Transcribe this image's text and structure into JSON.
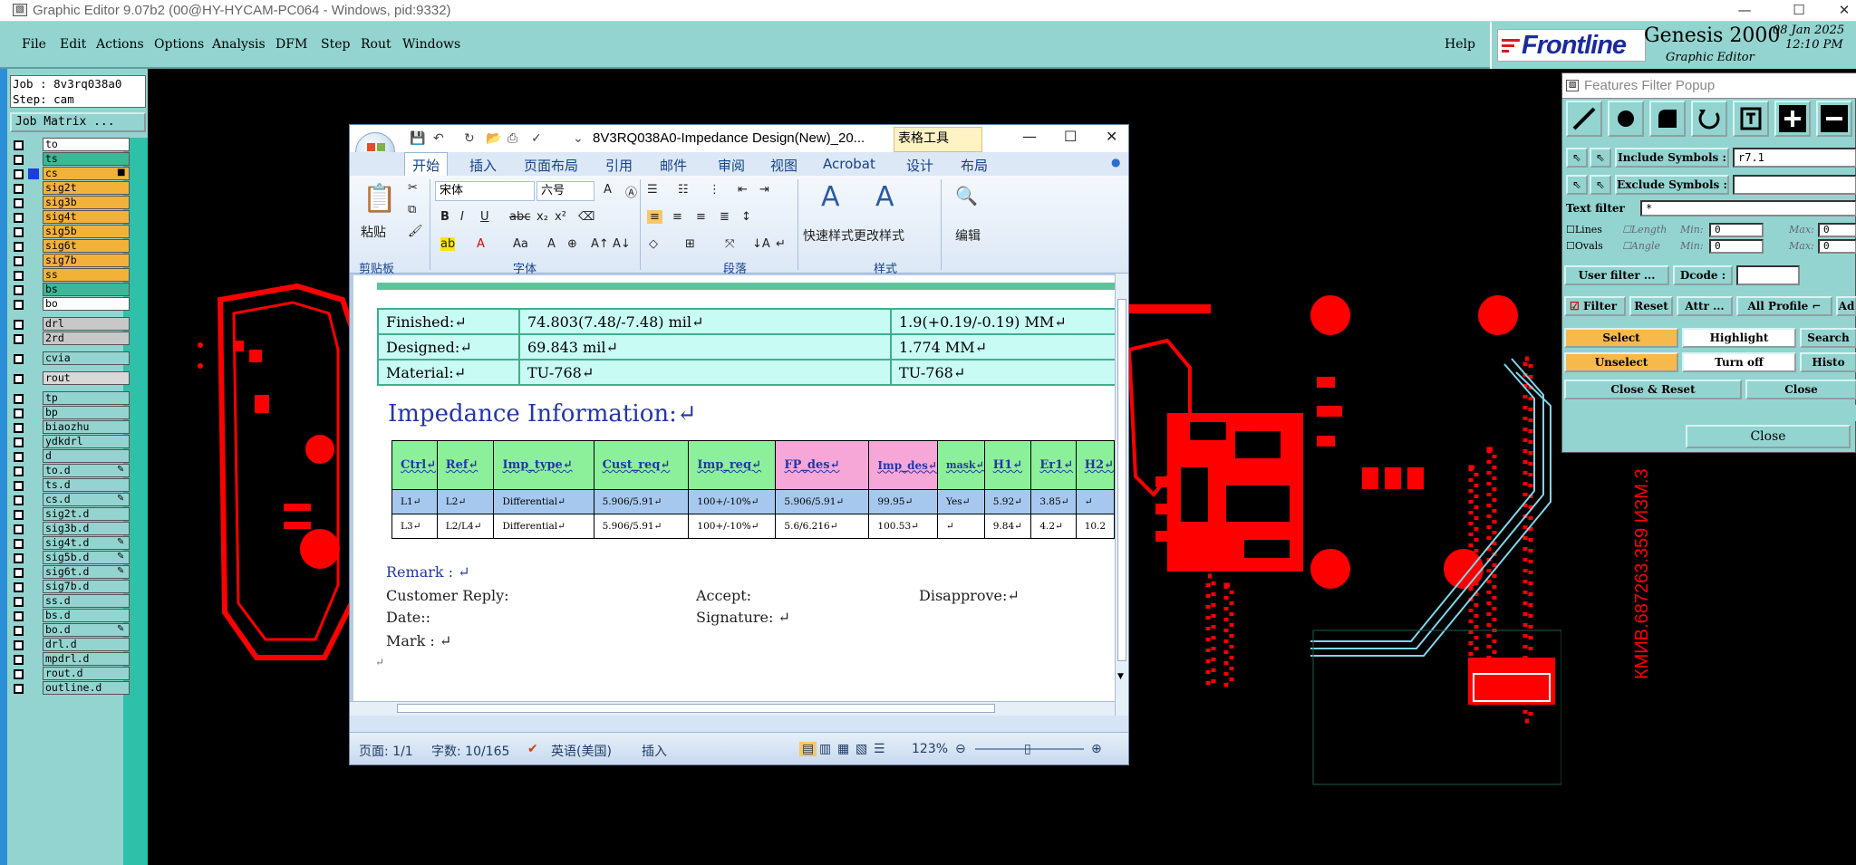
{
  "window": {
    "title": "Graphic Editor 9.07b2 (00@HY-HYCAM-PC064 - Windows, pid:9332)",
    "minimize": "—",
    "maximize": "☐",
    "close": "✕"
  },
  "menu": {
    "items": [
      "File",
      "Edit",
      "Actions",
      "Options",
      "Analysis",
      "DFM",
      "Step",
      "Rout",
      "Windows"
    ],
    "help": "Help"
  },
  "brand": {
    "logo_text": "Frontline",
    "product": "Genesis 2000",
    "subtitle": "Graphic Editor",
    "date": "08 Jan 2025",
    "time": "12:10 PM"
  },
  "job": {
    "job_line": "Job : 8v3rq038a0",
    "step_line": "Step: cam",
    "matrix_button": "Job Matrix ..."
  },
  "layers": [
    {
      "name": "to",
      "color": "#ffffff"
    },
    {
      "name": "ts",
      "color": "#3cb896"
    },
    {
      "name": "cs",
      "color": "#f2b23a",
      "selected": true,
      "mark": "■"
    },
    {
      "name": "sig2t",
      "color": "#f2b23a"
    },
    {
      "name": "sig3b",
      "color": "#f2b23a"
    },
    {
      "name": "sig4t",
      "color": "#f2b23a"
    },
    {
      "name": "sig5b",
      "color": "#f2b23a"
    },
    {
      "name": "sig6t",
      "color": "#f2b23a"
    },
    {
      "name": "sig7b",
      "color": "#f2b23a"
    },
    {
      "name": "ss",
      "color": "#f2b23a"
    },
    {
      "name": "bs",
      "color": "#3cb896"
    },
    {
      "name": "bo",
      "color": "#ffffff"
    },
    {
      "name": "drl",
      "color": "#c8c8c8",
      "gap": true
    },
    {
      "name": "2rd",
      "color": "#c8c8c8"
    },
    {
      "name": "cvia",
      "color": "#93d4d0",
      "gap": true
    },
    {
      "name": "rout",
      "color": "#d8d8d8",
      "gap": true
    },
    {
      "name": "tp",
      "color": "#93d4d0",
      "gap": true
    },
    {
      "name": "bp",
      "color": "#93d4d0"
    },
    {
      "name": "biaozhu",
      "color": "#93d4d0"
    },
    {
      "name": "ydkdrl",
      "color": "#93d4d0"
    },
    {
      "name": "d",
      "color": "#93d4d0"
    },
    {
      "name": "to.d",
      "color": "#93d4d0",
      "mark": "✎"
    },
    {
      "name": "ts.d",
      "color": "#93d4d0"
    },
    {
      "name": "cs.d",
      "color": "#93d4d0",
      "mark": "✎"
    },
    {
      "name": "sig2t.d",
      "color": "#93d4d0"
    },
    {
      "name": "sig3b.d",
      "color": "#93d4d0"
    },
    {
      "name": "sig4t.d",
      "color": "#93d4d0",
      "mark": "✎"
    },
    {
      "name": "sig5b.d",
      "color": "#93d4d0",
      "mark": "✎"
    },
    {
      "name": "sig6t.d",
      "color": "#93d4d0",
      "mark": "✎"
    },
    {
      "name": "sig7b.d",
      "color": "#93d4d0"
    },
    {
      "name": "ss.d",
      "color": "#93d4d0"
    },
    {
      "name": "bs.d",
      "color": "#93d4d0"
    },
    {
      "name": "bo.d",
      "color": "#93d4d0",
      "mark": "✎"
    },
    {
      "name": "drl.d",
      "color": "#93d4d0"
    },
    {
      "name": "mpdrl.d",
      "color": "#93d4d0"
    },
    {
      "name": "rout.d",
      "color": "#93d4d0"
    },
    {
      "name": "outline.d",
      "color": "#93d4d0"
    }
  ],
  "canvas_text": "КМИВ.687263.359 ИЗМ.3",
  "filter_popup": {
    "title": "Features Filter Popup",
    "include_label": "Include Symbols :",
    "include_value": "r7.1",
    "exclude_label": "Exclude Symbols :",
    "exclude_value": "",
    "text_filter_label": "Text filter",
    "text_filter_value": "*",
    "lines": "Lines",
    "ovals": "Ovals",
    "length": "Length",
    "angle": "Angle",
    "min": "Min:",
    "max": "Max:",
    "min_len": "0",
    "max_len": "0",
    "min_ang": "0",
    "max_ang": "0",
    "user_filter": "User filter ...",
    "dcode": "Dcode :",
    "filter": "Filter",
    "reset": "Reset",
    "attr": "Attr ...",
    "all_profile": "All Profile",
    "ad": "Ad",
    "select": "Select",
    "highlight": "Highlight",
    "search": "Search",
    "unselect": "Unselect",
    "turn_off": "Turn off",
    "history": "Histo",
    "close_reset": "Close & Reset",
    "close": "Close",
    "close2": "Close"
  },
  "word": {
    "title": "8V3RQ038A0-Impedance Design(New)_20...",
    "context_tab": "表格工具",
    "tabs": [
      "开始",
      "插入",
      "页面布局",
      "引用",
      "邮件",
      "审阅",
      "视图",
      "Acrobat",
      "设计",
      "布局"
    ],
    "ribbon": {
      "paste": "粘贴",
      "font_name": "宋体",
      "font_size": "六号",
      "quick_styles": "快速样式",
      "change_styles": "更改样式",
      "edit": "编辑",
      "group_clipboard": "剪贴板",
      "group_font": "字体",
      "group_paragraph": "段落",
      "group_styles": "样式"
    },
    "info_rows": [
      [
        "Finished:↵",
        "74.803(7.48/-7.48) mil↵",
        "1.9(+0.19/-0.19) MM↵"
      ],
      [
        "Designed:↵",
        "69.843 mil↵",
        "1.774 MM↵"
      ],
      [
        "Material:↵",
        "TU-768↵",
        "TU-768↵"
      ]
    ],
    "impedance_heading": "Impedance Information:↵",
    "imp_headers": [
      "Ctrl↵",
      "Ref↵",
      "Imp_type↵",
      "Cust_req↵",
      "Imp_req↵",
      "FP_des↵",
      "Imp_des↵",
      "mask↵",
      "H1↵",
      "Er1↵",
      "H2↵"
    ],
    "imp_rows": [
      [
        "L1↵",
        "L2↵",
        "Differential↵",
        "5.906/5.91↵",
        "100+/-10%↵",
        "5.906/5.91↵",
        "99.95↵",
        "Yes↵",
        "5.92↵",
        "3.85↵",
        "↵"
      ],
      [
        "L3↵",
        "L2/L4↵",
        "Differential↵",
        "5.906/5.91↵",
        "100+/-10%↵",
        "5.6/6.216↵",
        "100.53↵",
        "↵",
        "9.84↵",
        "4.2↵",
        "10.2"
      ]
    ],
    "remark": "Remark : ↵",
    "customer_reply": "Customer Reply:",
    "accept": "Accept:",
    "disapprove": "Disapprove:↵",
    "date": "Date::",
    "signature": "Signature: ↵",
    "mark": "Mark : ↵",
    "para": "↵",
    "status": {
      "page": "页面: 1/1",
      "words": "字数: 10/165",
      "language": "英语(美国)",
      "insert": "插入",
      "zoom": "123%"
    }
  },
  "colors": {
    "cde_teal": "#93d4d0",
    "pcb_red": "#ff0000",
    "trace_cyan": "#7fd6e8"
  }
}
